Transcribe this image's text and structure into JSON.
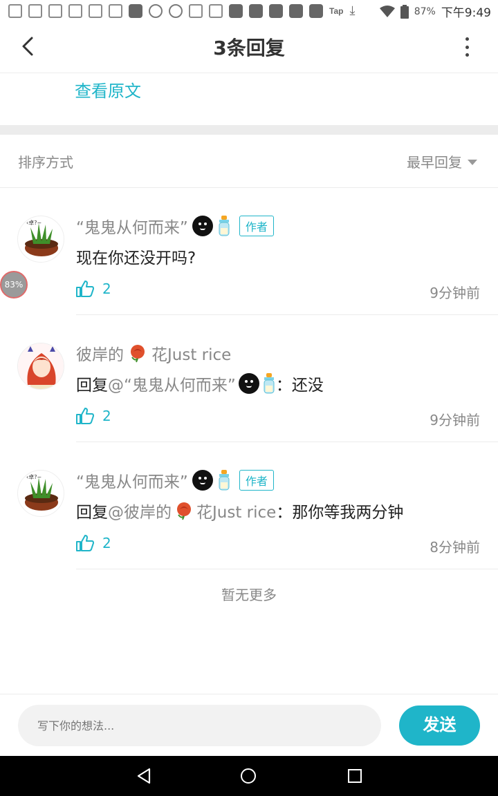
{
  "status_bar": {
    "tap_label": "Tap",
    "battery": "87%",
    "time": "下午9:49"
  },
  "header": {
    "title": "3条回复"
  },
  "view_original": "查看原文",
  "sort": {
    "label": "排序方式",
    "value": "最早回复"
  },
  "floating_badge": "83%",
  "replies": [
    {
      "name": "“鬼鬼从何而来”",
      "author_badge": "作者",
      "content": "现在你还没开吗?",
      "likes": "2",
      "time": "9分钟前"
    },
    {
      "name_prefix": "彼岸的",
      "name_suffix": "花Just rice",
      "reply_prefix": "回复",
      "mention": "@“鬼鬼从何而来”",
      "content": "：还没",
      "likes": "2",
      "time": "9分钟前"
    },
    {
      "name": "“鬼鬼从何而来”",
      "author_badge": "作者",
      "reply_prefix": "回复",
      "mention_prefix": "@彼岸的",
      "mention_suffix": "花Just rice",
      "content": "：那你等我两分钟",
      "likes": "2",
      "time": "8分钟前"
    }
  ],
  "no_more": "暂无更多",
  "composer": {
    "placeholder": "写下你的想法...",
    "send_label": "发送"
  },
  "colors": {
    "accent": "#1fb5c9",
    "muted_text": "#888888",
    "divider": "#ececec"
  }
}
